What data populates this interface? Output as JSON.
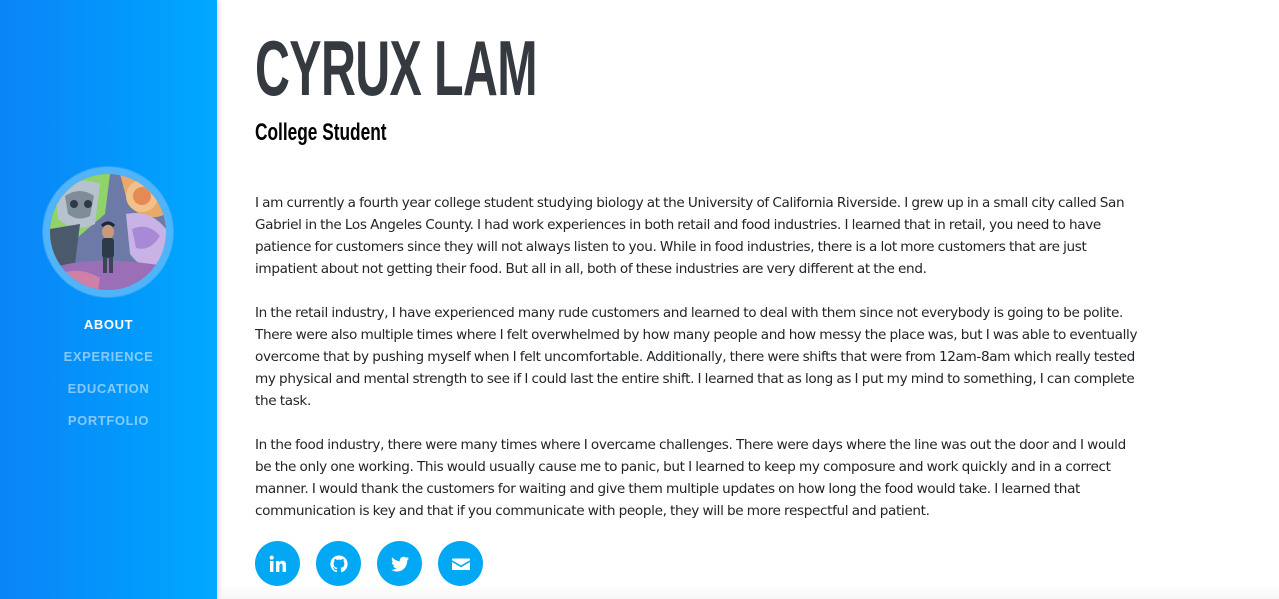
{
  "profile": {
    "name": "Cyrux Lam",
    "subtitle": "College Student",
    "avatar_alt": "Profile photo"
  },
  "nav": {
    "items": [
      {
        "label": "ABOUT",
        "active": true
      },
      {
        "label": "EXPERIENCE",
        "active": false
      },
      {
        "label": "EDUCATION",
        "active": false
      },
      {
        "label": "PORTFOLIO",
        "active": false
      }
    ]
  },
  "bio": {
    "paragraphs": [
      "I am currently a fourth year college student studying biology at the University of California Riverside. I grew up in a small city called San Gabriel in the Los Angeles County. I had work experiences in both retail and food industries. I learned that in retail, you need to have patience for customers since they will not always listen to you. While in food industries, there is a lot more customers that are just impatient about not getting their food. But all in all, both of these industries are very different at the end.",
      "In the retail industry, I have experienced many rude customers and learned to deal with them since not everybody is going to be polite. There were also multiple times where I felt overwhelmed by how many people and how messy the place was, but I was able to eventually overcome that by pushing myself when I felt uncomfortable. Additionally, there were shifts that were from 12am-8am which really tested my physical and mental strength to see if I could last the entire shift. I learned that as long as I put my mind to something, I can complete the task.",
      "In the food industry, there were many times where I overcame challenges. There were days where the line was out the door and I would be the only one working. This would usually cause me to panic, but I learned to keep my composure and work quickly and in a correct manner. I would thank the customers for waiting and give them multiple updates on how long the food would take. I learned that communication is key and that if you communicate with people, they will be more respectful and patient."
    ]
  },
  "social": [
    {
      "icon": "linkedin-icon"
    },
    {
      "icon": "github-icon"
    },
    {
      "icon": "twitter-icon"
    },
    {
      "icon": "envelope-icon"
    }
  ],
  "colors": {
    "sidebar_start": "#0b84f7",
    "sidebar_end": "#00a9ff",
    "accent": "#02a8f3",
    "heading": "#343a40",
    "body_text": "#212529"
  }
}
